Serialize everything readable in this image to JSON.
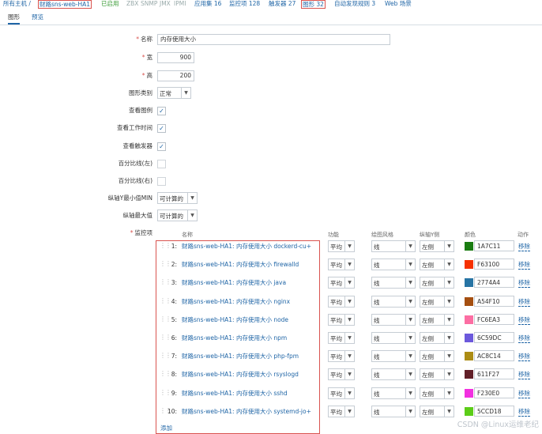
{
  "nav": {
    "all_hosts": "所有主机 /",
    "host": "财路sns-web-HA1",
    "enabled": "已启用",
    "zbx": "ZBX",
    "snmp": "SNMP",
    "jmx": "JMX",
    "ipmi": "IPMI",
    "apps": "应用集 16",
    "items": "监控项 128",
    "triggers": "触发器 27",
    "graphs": "图形 32",
    "discovery": "自动发现规则 3",
    "web": "Web 场景"
  },
  "tabs": {
    "graph": "图形",
    "preview": "预览"
  },
  "form": {
    "name_label": "名称",
    "name_value": "内存使用大小",
    "width_label": "宽",
    "width_value": "900",
    "height_label": "高",
    "height_value": "200",
    "type_label": "图形类别",
    "type_value": "正常",
    "legend_label": "查看图例",
    "worktime_label": "查看工作时间",
    "triggers_label": "查看触发器",
    "pct_left_label": "百分比线(左)",
    "pct_right_label": "百分比线(右)",
    "ymin_label": "纵轴Y最小值MIN",
    "ymin_value": "可计算的",
    "ymax_label": "纵轴最大值",
    "ymax_value": "可计算的",
    "items_label": "监控项"
  },
  "items_header": {
    "name": "名称",
    "func": "功能",
    "style": "绘图风格",
    "yaxis": "纵轴Y侧",
    "color": "颜色",
    "action": "动作"
  },
  "items": [
    {
      "idx": "1:",
      "name": "财路sns-web-HA1: 内存使用大小 dockerd-cu+",
      "func": "平均",
      "style": "线",
      "axis": "左侧",
      "color_hex": "#1A7C11",
      "color": "1A7C11",
      "remove": "移除"
    },
    {
      "idx": "2:",
      "name": "财路sns-web-HA1: 内存使用大小 firewalld",
      "func": "平均",
      "style": "线",
      "axis": "左侧",
      "color_hex": "#F63100",
      "color": "F63100",
      "remove": "移除"
    },
    {
      "idx": "3:",
      "name": "财路sns-web-HA1: 内存使用大小 java",
      "func": "平均",
      "style": "线",
      "axis": "左侧",
      "color_hex": "#2774A4",
      "color": "2774A4",
      "remove": "移除"
    },
    {
      "idx": "4:",
      "name": "财路sns-web-HA1: 内存使用大小 nginx",
      "func": "平均",
      "style": "线",
      "axis": "左侧",
      "color_hex": "#A54F10",
      "color": "A54F10",
      "remove": "移除"
    },
    {
      "idx": "5:",
      "name": "财路sns-web-HA1: 内存使用大小 node",
      "func": "平均",
      "style": "线",
      "axis": "左侧",
      "color_hex": "#FC6EA3",
      "color": "FC6EA3",
      "remove": "移除"
    },
    {
      "idx": "6:",
      "name": "财路sns-web-HA1: 内存使用大小 npm",
      "func": "平均",
      "style": "线",
      "axis": "左侧",
      "color_hex": "#6C59DC",
      "color": "6C59DC",
      "remove": "移除"
    },
    {
      "idx": "7:",
      "name": "财路sns-web-HA1: 内存使用大小 php-fpm",
      "func": "平均",
      "style": "线",
      "axis": "左侧",
      "color_hex": "#AC8C14",
      "color": "AC8C14",
      "remove": "移除"
    },
    {
      "idx": "8:",
      "name": "财路sns-web-HA1: 内存使用大小 rsyslogd",
      "func": "平均",
      "style": "线",
      "axis": "左侧",
      "color_hex": "#611F27",
      "color": "611F27",
      "remove": "移除"
    },
    {
      "idx": "9:",
      "name": "财路sns-web-HA1: 内存使用大小 sshd",
      "func": "平均",
      "style": "线",
      "axis": "左侧",
      "color_hex": "#F230E0",
      "color": "F230E0",
      "remove": "移除"
    },
    {
      "idx": "10:",
      "name": "财路sns-web-HA1: 内存使用大小 systemd-jo+",
      "func": "平均",
      "style": "线",
      "axis": "左侧",
      "color_hex": "#5CCD18",
      "color": "5CCD18",
      "remove": "移除"
    }
  ],
  "add_label": "添加",
  "watermark": "CSDN @Linux运维老纪"
}
